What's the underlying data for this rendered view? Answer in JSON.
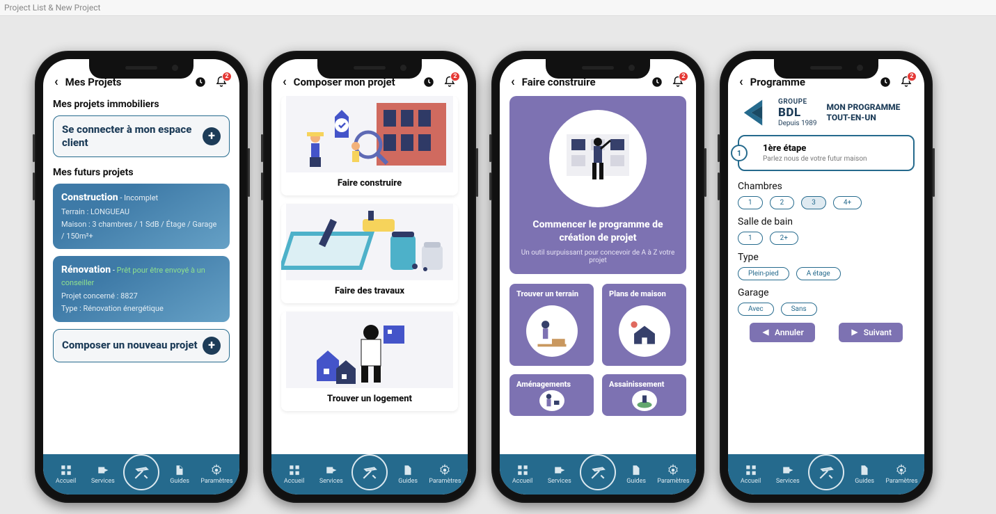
{
  "page_title": "Project List & New Project",
  "notification_count": "2",
  "nav": {
    "home": "Accueil",
    "services": "Services",
    "guides": "Guides",
    "settings": "Paramètres"
  },
  "screen1": {
    "header": "Mes Projets",
    "section_clients": "Mes projets immobiliers",
    "login_card": "Se connecter à mon espace client",
    "section_future": "Mes futurs projets",
    "proj1": {
      "title": "Construction",
      "status": "Incomplet",
      "line1": "Terrain : LONGUEAU",
      "line2": "Maison : 3 chambres / 1 SdB / Étage / Garage / 150m²+"
    },
    "proj2": {
      "title": "Rénovation",
      "status": "Prêt pour être envoyé à un conseiller",
      "line1": "Projet concerné : 8827",
      "line2": "Type : Rénovation énergétique"
    },
    "compose_card": "Composer un nouveau projet"
  },
  "screen2": {
    "header": "Composer mon projet",
    "card1": "Faire construire",
    "card2": "Faire des travaux",
    "card3": "Trouver un logement"
  },
  "screen3": {
    "header": "Faire construire",
    "hero_title": "Commencer le programme de création de projet",
    "hero_sub": "Un outil surpuissant pour concevoir de A à Z votre projet",
    "tile1": "Trouver un terrain",
    "tile2": "Plans de maison",
    "tile3": "Aménagements",
    "tile4": "Assainissement"
  },
  "screen4": {
    "header": "Programme",
    "logo_group": "GROUPE",
    "logo_name": "BDL",
    "logo_since": "Depuis 1989",
    "logo_tag1": "MON PROGRAMME",
    "logo_tag2": "TOUT-EN-UN",
    "step_num": "1",
    "step_title": "1ère étape",
    "step_sub": "Parlez nous de votre futur maison",
    "g1": {
      "label": "Chambres",
      "opts": [
        "1",
        "2",
        "3",
        "4+"
      ],
      "sel": 2
    },
    "g2": {
      "label": "Salle de bain",
      "opts": [
        "1",
        "2+"
      ],
      "sel": -1
    },
    "g3": {
      "label": "Type",
      "opts": [
        "Plein-pied",
        "A étage"
      ],
      "sel": -1
    },
    "g4": {
      "label": "Garage",
      "opts": [
        "Avec",
        "Sans"
      ],
      "sel": -1
    },
    "btn_cancel": "Annuler",
    "btn_next": "Suivant"
  }
}
